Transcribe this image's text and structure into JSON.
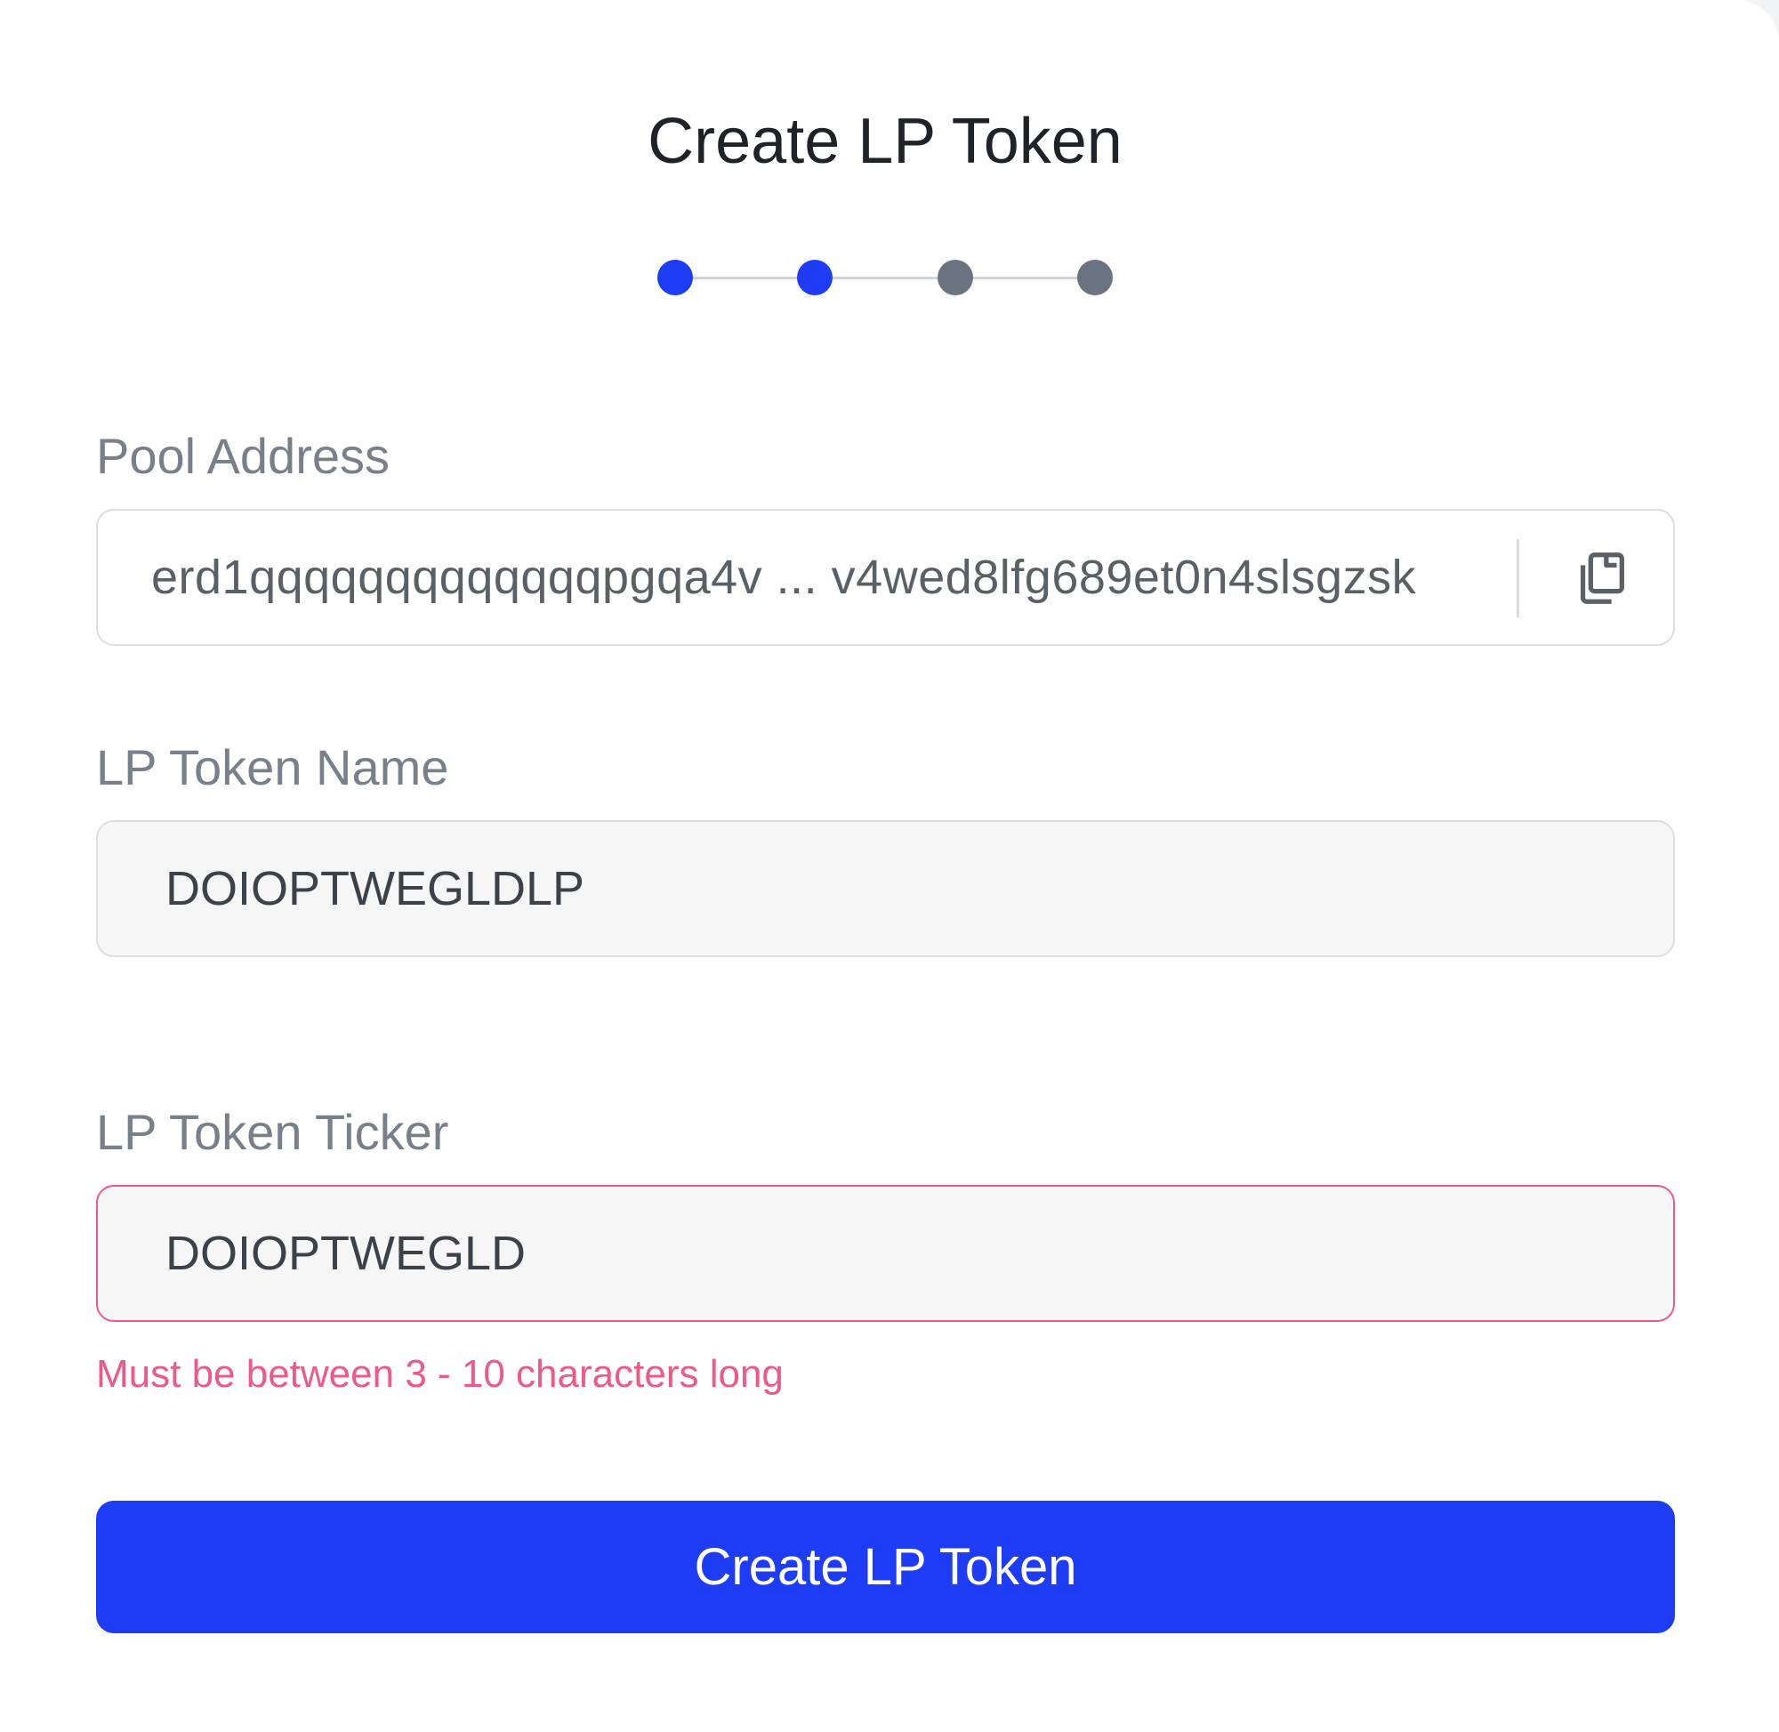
{
  "header": {
    "title": "Create LP Token"
  },
  "stepper": {
    "total_steps": 4,
    "completed_steps": 2,
    "active_color": "#1f3cf5",
    "inactive_color": "#6b7280"
  },
  "pool_address": {
    "label": "Pool Address",
    "value": "erd1qqqqqqqqqqqqqpgqa4v ... v4wed8lfg689et0n4slsgzsk",
    "copy_icon": "copy-icon"
  },
  "lp_token_name": {
    "label": "LP Token Name",
    "value": "DOIOPTWEGLDLP"
  },
  "lp_token_ticker": {
    "label": "LP Token Ticker",
    "value": "DOIOPTWEGLD",
    "error": "Must be between 3 - 10 characters long",
    "error_color": "#ec5a86"
  },
  "actions": {
    "submit_label": "Create LP Token"
  }
}
